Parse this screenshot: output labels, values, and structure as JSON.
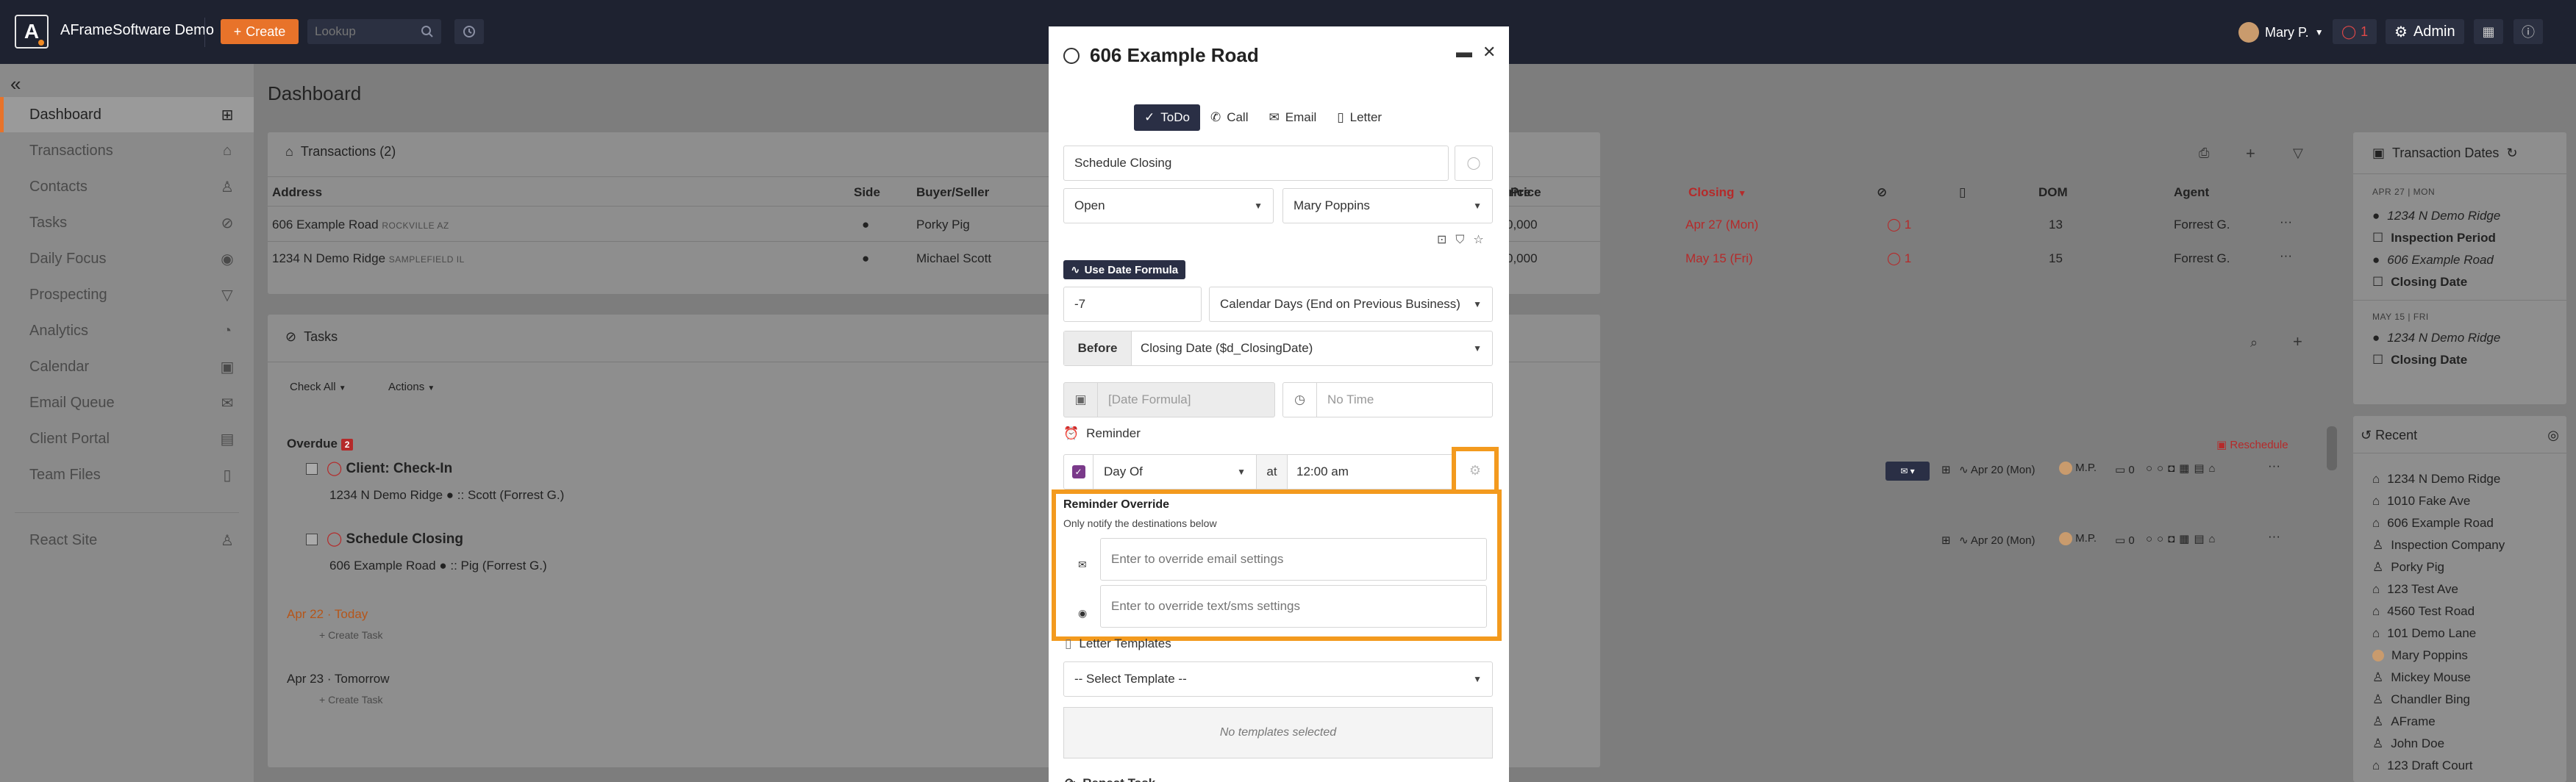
{
  "topbar": {
    "logo": "A",
    "brand": "AFrameSoftware Demo",
    "create_label": "Create",
    "lookup_placeholder": "Lookup",
    "user": "Mary P.",
    "alerts": "1",
    "admin": "Admin"
  },
  "sidebar": {
    "items": [
      {
        "label": "Dashboard",
        "icon": "grid-icon"
      },
      {
        "label": "Transactions",
        "icon": "house-icon"
      },
      {
        "label": "Contacts",
        "icon": "person-icon"
      },
      {
        "label": "Tasks",
        "icon": "check-circle-icon"
      },
      {
        "label": "Daily Focus",
        "icon": "target-icon"
      },
      {
        "label": "Prospecting",
        "icon": "filter-icon"
      },
      {
        "label": "Analytics",
        "icon": "chart-icon"
      },
      {
        "label": "Calendar",
        "icon": "calendar-icon"
      },
      {
        "label": "Email Queue",
        "icon": "mail-icon"
      },
      {
        "label": "Client Portal",
        "icon": "portal-icon"
      },
      {
        "label": "Team Files",
        "icon": "file-icon"
      },
      {
        "label": "React Site",
        "icon": "user-icon"
      }
    ]
  },
  "main": {
    "title": "Dashboard",
    "transactions": {
      "header": "Transactions (2)",
      "columns": {
        "address": "Address",
        "side": "Side",
        "buyer": "Buyer/Seller",
        "price": "Price",
        "closing": "Closing",
        "dom": "DOM",
        "agent": "Agent"
      },
      "rows": [
        {
          "address": "606 Example Road",
          "city": "ROCKVILLE AZ",
          "buyer": "Porky Pig",
          "price": "0,000",
          "closing": "Apr 27 (Mon)",
          "alerts": "1",
          "dom": "13",
          "agent": "Forrest G."
        },
        {
          "address": "1234 N Demo Ridge",
          "city": "SAMPLEFIELD IL",
          "buyer": "Michael Scott",
          "price": "0,000",
          "closing": "May 15 (Fri)",
          "alerts": "1",
          "dom": "15",
          "agent": "Forrest G."
        }
      ]
    },
    "tasks": {
      "header": "Tasks",
      "check_all": "Check All",
      "actions": "Actions",
      "overdue_label": "Overdue",
      "overdue_count": "2",
      "reschedule": "Reschedule",
      "items": [
        {
          "title": "Client: Check-In",
          "sub": "1234 N Demo Ridge",
          "who": ":: Scott (Forrest G.)",
          "date": "Apr 20 (Mon)",
          "user": "M.P.",
          "comments": "0"
        },
        {
          "title": "Schedule Closing",
          "sub": "606 Example Road",
          "who": ":: Pig (Forrest G.)",
          "date": "Apr 20 (Mon)",
          "user": "M.P.",
          "comments": "0"
        }
      ],
      "today_date": "Apr 22",
      "today_label": "Today",
      "tomorrow_date": "Apr 23",
      "tomorrow_label": "Tomorrow",
      "create_task": "+ Create Task"
    }
  },
  "right": {
    "dates_header": "Transaction Dates",
    "group1": "APR 27 | MON",
    "group1_items": [
      "1234 N Demo Ridge",
      "Inspection Period",
      "606 Example Road",
      "Closing Date"
    ],
    "group2": "MAY 15 | FRI",
    "group2_items": [
      "1234 N Demo Ridge",
      "Closing Date"
    ],
    "recent_header": "Recent",
    "recent_items": [
      "1234 N Demo Ridge",
      "1010 Fake Ave",
      "606 Example Road",
      "Inspection Company",
      "Porky Pig",
      "123 Test Ave",
      "4560 Test Road",
      "101 Demo Lane",
      "Mary Poppins",
      "Mickey Mouse",
      "Chandler Bing",
      "AFrame",
      "John Doe",
      "123 Draft Court"
    ]
  },
  "modal": {
    "title": "606 Example Road",
    "tabs": [
      "ToDo",
      "Call",
      "Email",
      "Letter"
    ],
    "task_name": "Schedule Closing",
    "status": "Open",
    "assignee": "Mary Poppins",
    "use_formula": "Use Date Formula",
    "offset": "-7",
    "day_type": "Calendar Days (End on Previous Business)",
    "before": "Before",
    "anchor": "Closing Date ($d_ClosingDate)",
    "date_formula": "[Date Formula]",
    "time": "No Time",
    "reminder": "Reminder",
    "reminder_when": "Day Of",
    "at": "at",
    "reminder_time": "12:00 am",
    "override_title": "Reminder Override",
    "override_sub": "Only notify the destinations below",
    "email_placeholder": "Enter to override email settings",
    "sms_placeholder": "Enter to override text/sms settings",
    "letter_templates": "Letter Templates",
    "select_template": "-- Select Template --",
    "no_templates": "No templates selected",
    "repeat_task": "Repeat Task"
  },
  "colors": {
    "accent": "#e8732a",
    "highlight": "#f39a1e",
    "navy": "#2a2f45",
    "danger": "#b52a2a"
  }
}
